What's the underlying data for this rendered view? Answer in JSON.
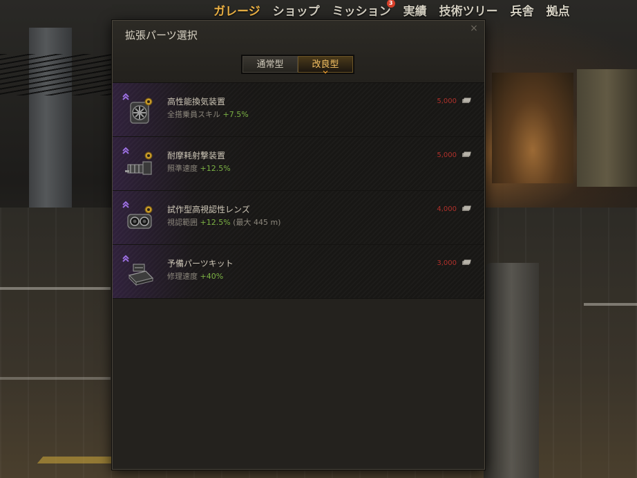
{
  "nav": {
    "items": [
      {
        "label": "ガレージ",
        "active": true
      },
      {
        "label": "ショップ",
        "active": false
      },
      {
        "label": "ミッション",
        "active": false,
        "badge": "3"
      },
      {
        "label": "実績",
        "active": false
      },
      {
        "label": "技術ツリー",
        "active": false
      },
      {
        "label": "兵舎",
        "active": false
      },
      {
        "label": "拠点",
        "active": false
      }
    ]
  },
  "dialog": {
    "title": "拡張パーツ選択",
    "close_symbol": "×",
    "tabs": [
      {
        "label": "通常型",
        "active": false
      },
      {
        "label": "改良型",
        "active": true
      }
    ],
    "items": [
      {
        "name": "高性能換気装置",
        "desc_prefix": "全搭乗員スキル ",
        "bonus": "+7.5%",
        "desc_suffix": "",
        "price": "5,000",
        "icon": "ventilation-icon"
      },
      {
        "name": "耐摩耗射撃装置",
        "desc_prefix": "照準速度 ",
        "bonus": "+12.5%",
        "desc_suffix": "",
        "price": "5,000",
        "icon": "gun-rammer-icon"
      },
      {
        "name": "試作型高視認性レンズ",
        "desc_prefix": "視認範囲 ",
        "bonus": "+12.5%",
        "desc_suffix": " (最大 445 m)",
        "price": "4,000",
        "icon": "optics-icon"
      },
      {
        "name": "予備パーツキット",
        "desc_prefix": "修理速度 ",
        "bonus": "+40%",
        "desc_suffix": "",
        "price": "3,000",
        "icon": "toolbox-icon"
      }
    ]
  },
  "colors": {
    "accent": "#f2b646",
    "price": "#b0302a",
    "bonus": "#7cb344",
    "rank": "#8a5cd0"
  }
}
